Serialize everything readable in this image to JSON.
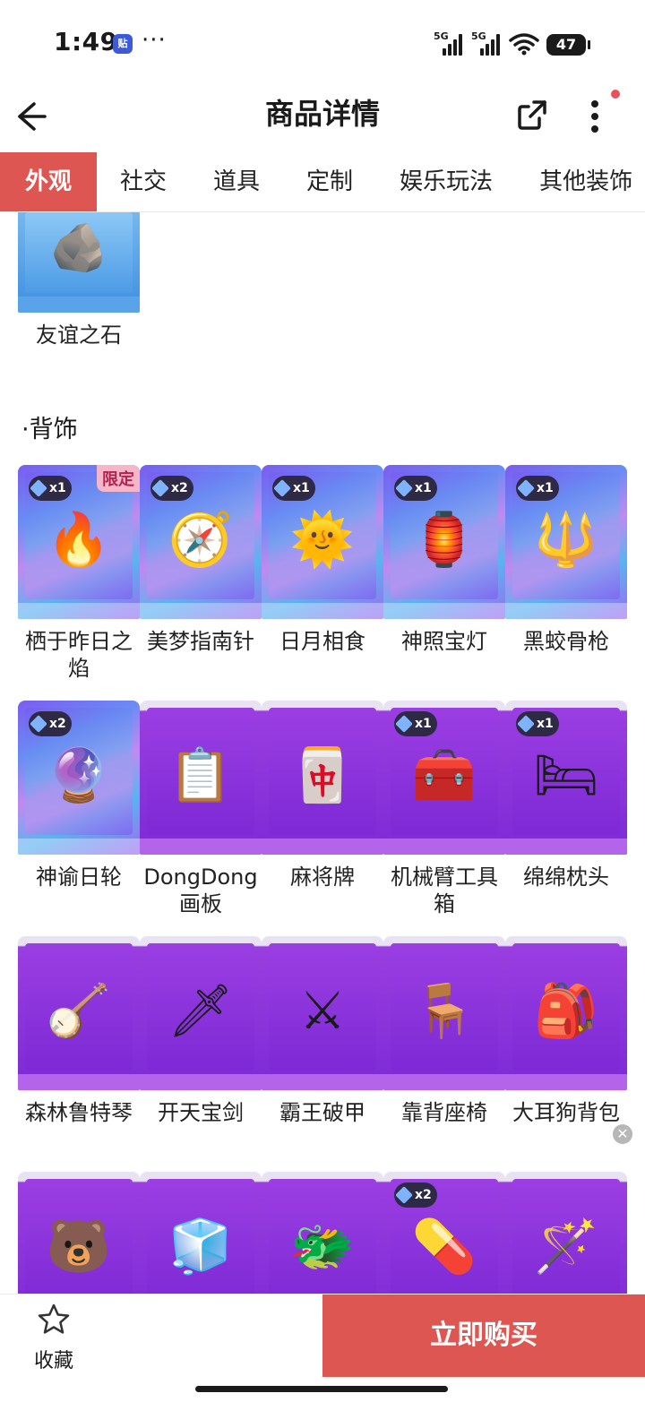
{
  "status": {
    "time": "1:49",
    "app_badge": "贴",
    "dots": "···",
    "net1": "5G",
    "net2": "5G",
    "battery": "47"
  },
  "header": {
    "title": "商品详情"
  },
  "tabs": [
    {
      "label": "外观",
      "active": true
    },
    {
      "label": "社交"
    },
    {
      "label": "道具"
    },
    {
      "label": "定制"
    },
    {
      "label": "娱乐玩法"
    },
    {
      "label": "其他装饰"
    }
  ],
  "top_item": {
    "name": "友谊之石",
    "art": "🪨"
  },
  "section": {
    "title": "·背饰"
  },
  "grid": {
    "rows": [
      [
        {
          "name": "栖于昨日之焰",
          "badge": "x1",
          "limited": "限定",
          "style": "holo",
          "art": "🔥"
        },
        {
          "name": "美梦指南针",
          "badge": "x2",
          "style": "holo",
          "art": "🧭"
        },
        {
          "name": "日月相食",
          "badge": "x1",
          "style": "holo",
          "art": "🌞"
        },
        {
          "name": "神照宝灯",
          "badge": "x1",
          "style": "holo",
          "art": "🏮"
        },
        {
          "name": "黑蛟骨枪",
          "badge": "x1",
          "style": "holo",
          "art": "🔱"
        }
      ],
      [
        {
          "name": "神谕日轮",
          "badge": "x2",
          "style": "holo",
          "art": "🔮"
        },
        {
          "name": "DongDong画板",
          "style": "purple",
          "art": "📋"
        },
        {
          "name": "麻将牌",
          "style": "purple",
          "art": "🀄"
        },
        {
          "name": "机械臂工具箱",
          "badge": "x1",
          "style": "purple",
          "art": "🧰"
        },
        {
          "name": "绵绵枕头",
          "badge": "x1",
          "style": "purple",
          "art": "🛏"
        }
      ],
      [
        {
          "name": "森林鲁特琴",
          "style": "purple",
          "art": "🪕"
        },
        {
          "name": "开天宝剑",
          "style": "purple",
          "art": "🗡"
        },
        {
          "name": "霸王破甲",
          "style": "purple",
          "art": "⚔"
        },
        {
          "name": "靠背座椅",
          "style": "purple",
          "art": "🪑"
        },
        {
          "name": "大耳狗背包",
          "style": "purple",
          "art": "🎒"
        }
      ],
      [
        {
          "name": "",
          "style": "purple",
          "art": "🐻"
        },
        {
          "name": "",
          "style": "purple",
          "art": "🧊"
        },
        {
          "name": "",
          "style": "purple",
          "art": "🐲"
        },
        {
          "name": "",
          "badge": "x2",
          "style": "purple",
          "art": "💊"
        },
        {
          "name": "",
          "style": "purple",
          "art": "🪄"
        }
      ]
    ]
  },
  "bottom": {
    "favorite_label": "收藏",
    "buy_label": "立即购买"
  },
  "colors": {
    "accent": "#de5651",
    "card_purple": "#8a33dc",
    "text": "#1a1a1a"
  }
}
